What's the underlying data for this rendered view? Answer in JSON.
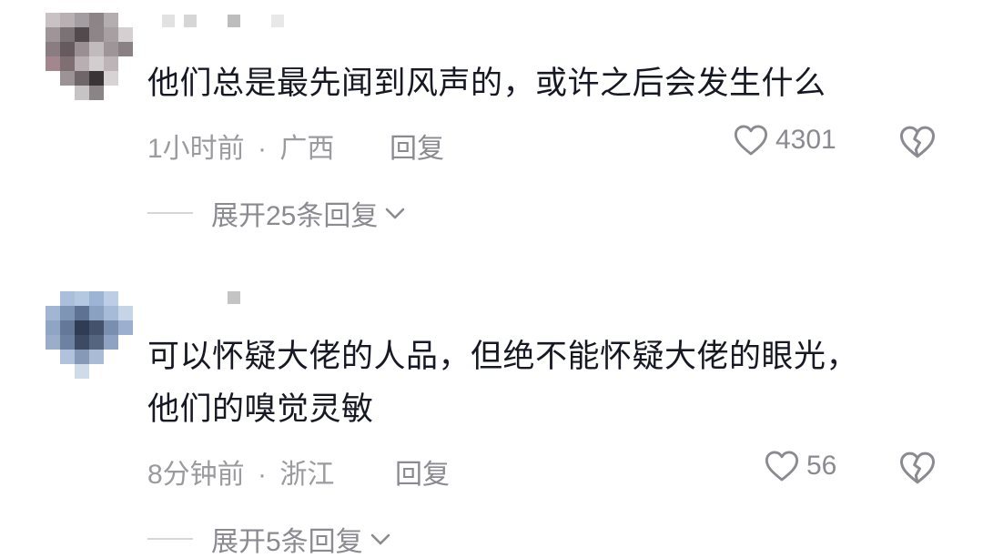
{
  "comments": [
    {
      "text": "他们总是最先闻到风声的，或许之后会发生什么",
      "time": "1小时前",
      "separator": "·",
      "location": "广西",
      "reply_label": "回复",
      "likes": "4301",
      "expand_label": "展开25条回复"
    },
    {
      "text_line1": "可以怀疑大佬的人品，但绝不能怀疑大佬的眼光，",
      "text_line2": "他们的嗅觉灵敏",
      "time": "8分钟前",
      "separator": "·",
      "location": "浙江",
      "reply_label": "回复",
      "likes": "56",
      "expand_label": "展开5条回复"
    }
  ],
  "icons": {
    "like": "heart-outline-icon",
    "dislike": "broken-heart-icon",
    "expand": "chevron-down-icon"
  },
  "colors": {
    "text": "#161823",
    "meta": "#9a9a9f",
    "action": "#8a8a90"
  }
}
